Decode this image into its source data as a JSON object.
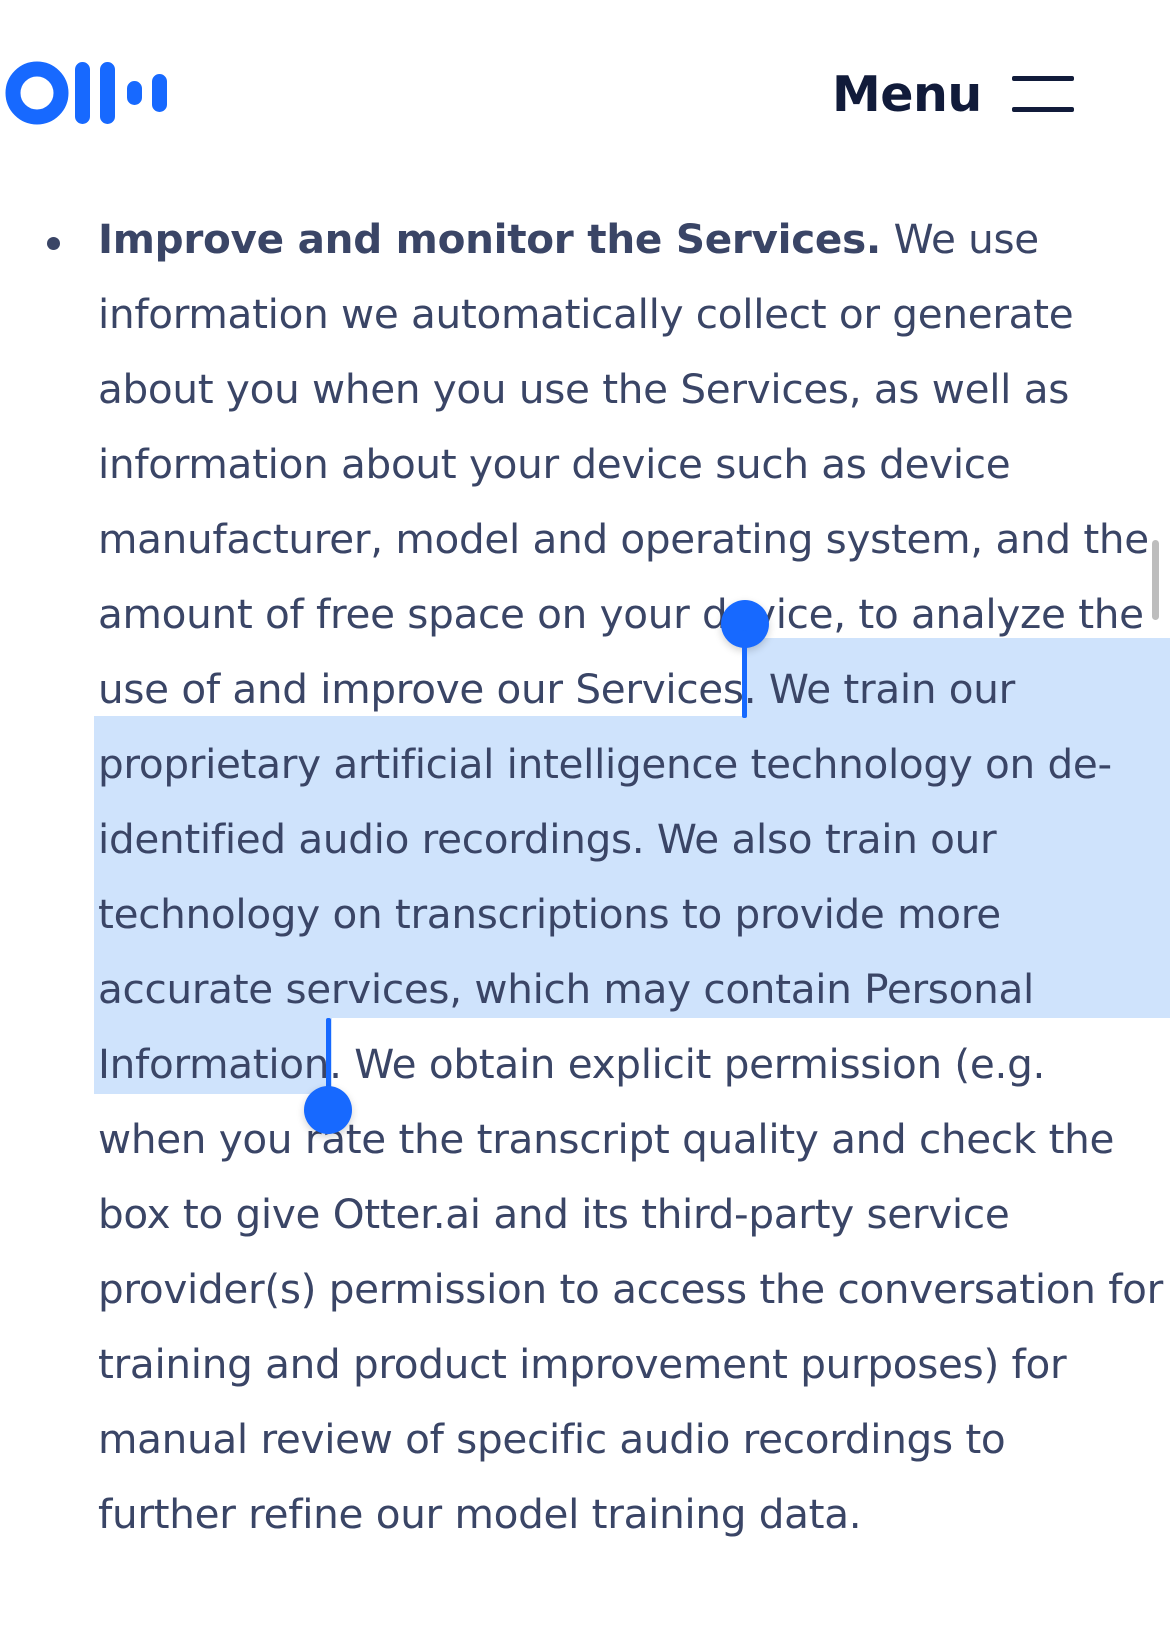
{
  "header": {
    "logo_name": "Otter.ai",
    "menu_label": "Menu",
    "brand_color": "#1769ff"
  },
  "section": {
    "bullet_heading": "Improve and monitor the Services.",
    "lines": [
      " We use",
      "information we automatically collect or generate",
      "about you when you use the Services, as well as",
      "information about your device such as device",
      "manufacturer, model and operating system, and the",
      "amount of free space on your device, to analyze the",
      "use of and improve our Services. ",
      "We train our",
      "proprietary artificial intelligence technology on de-",
      "identified audio recordings. We also train our",
      "technology on transcriptions to provide more",
      "accurate services, which may contain Personal",
      "Information",
      ". We obtain explicit permission (e.g.",
      "when you rate the transcript quality and check the",
      "box to give Otter.ai and its third-party service",
      "provider(s) permission to access the conversation for",
      "training and product improvement purposes)  for",
      "manual review of specific audio recordings to",
      "further refine our model training data."
    ]
  },
  "selection": {
    "highlight_color": "#cfe3fc",
    "handle_color": "#1769ff"
  }
}
